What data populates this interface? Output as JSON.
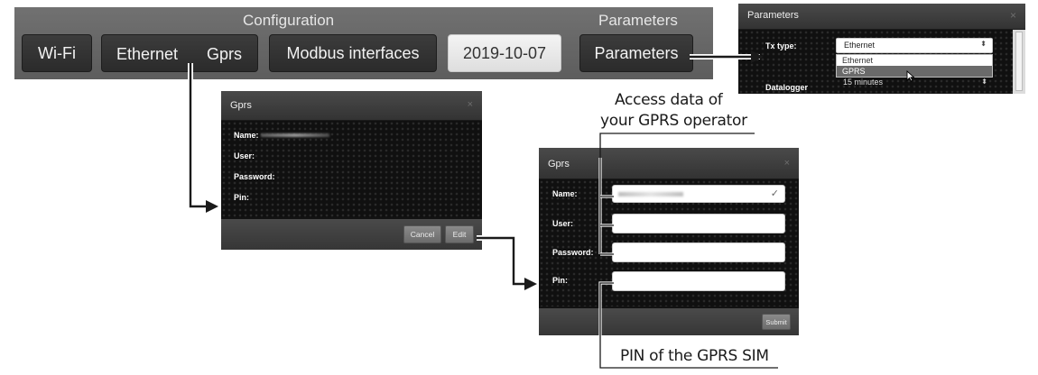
{
  "config_bar": {
    "configuration_title": "Configuration",
    "parameters_title": "Parameters",
    "buttons": {
      "wifi": "Wi-Fi",
      "ethernet": "Ethernet",
      "gprs": "Gprs",
      "modbus": "Modbus interfaces",
      "date": "2019-10-07",
      "parameters": "Parameters"
    }
  },
  "parameters_dialog": {
    "title": "Parameters",
    "close_glyph": "×",
    "tx_type_label": "Tx type:",
    "tx_type_value": "Ethernet",
    "tx_options": [
      "Ethernet",
      "GPRS"
    ],
    "datalogger_label": "Datalogger",
    "datalogger_value": "15 minutes"
  },
  "gprs_view": {
    "title": "Gprs",
    "close_glyph": "×",
    "name_label": "Name:",
    "user_label": "User:",
    "password_label": "Password:",
    "pin_label": "Pin:",
    "cancel": "Cancel",
    "edit": "Edit"
  },
  "gprs_edit": {
    "title": "Gprs",
    "close_glyph": "×",
    "name_label": "Name:",
    "user_label": "User:",
    "password_label": "Password:",
    "pin_label": "Pin:",
    "submit": "Submit",
    "check_glyph": "✓"
  },
  "annotations": {
    "access_line1": "Access data of",
    "access_line2": "your GPRS operator",
    "pin_note": "PIN of the GPRS SIM"
  }
}
